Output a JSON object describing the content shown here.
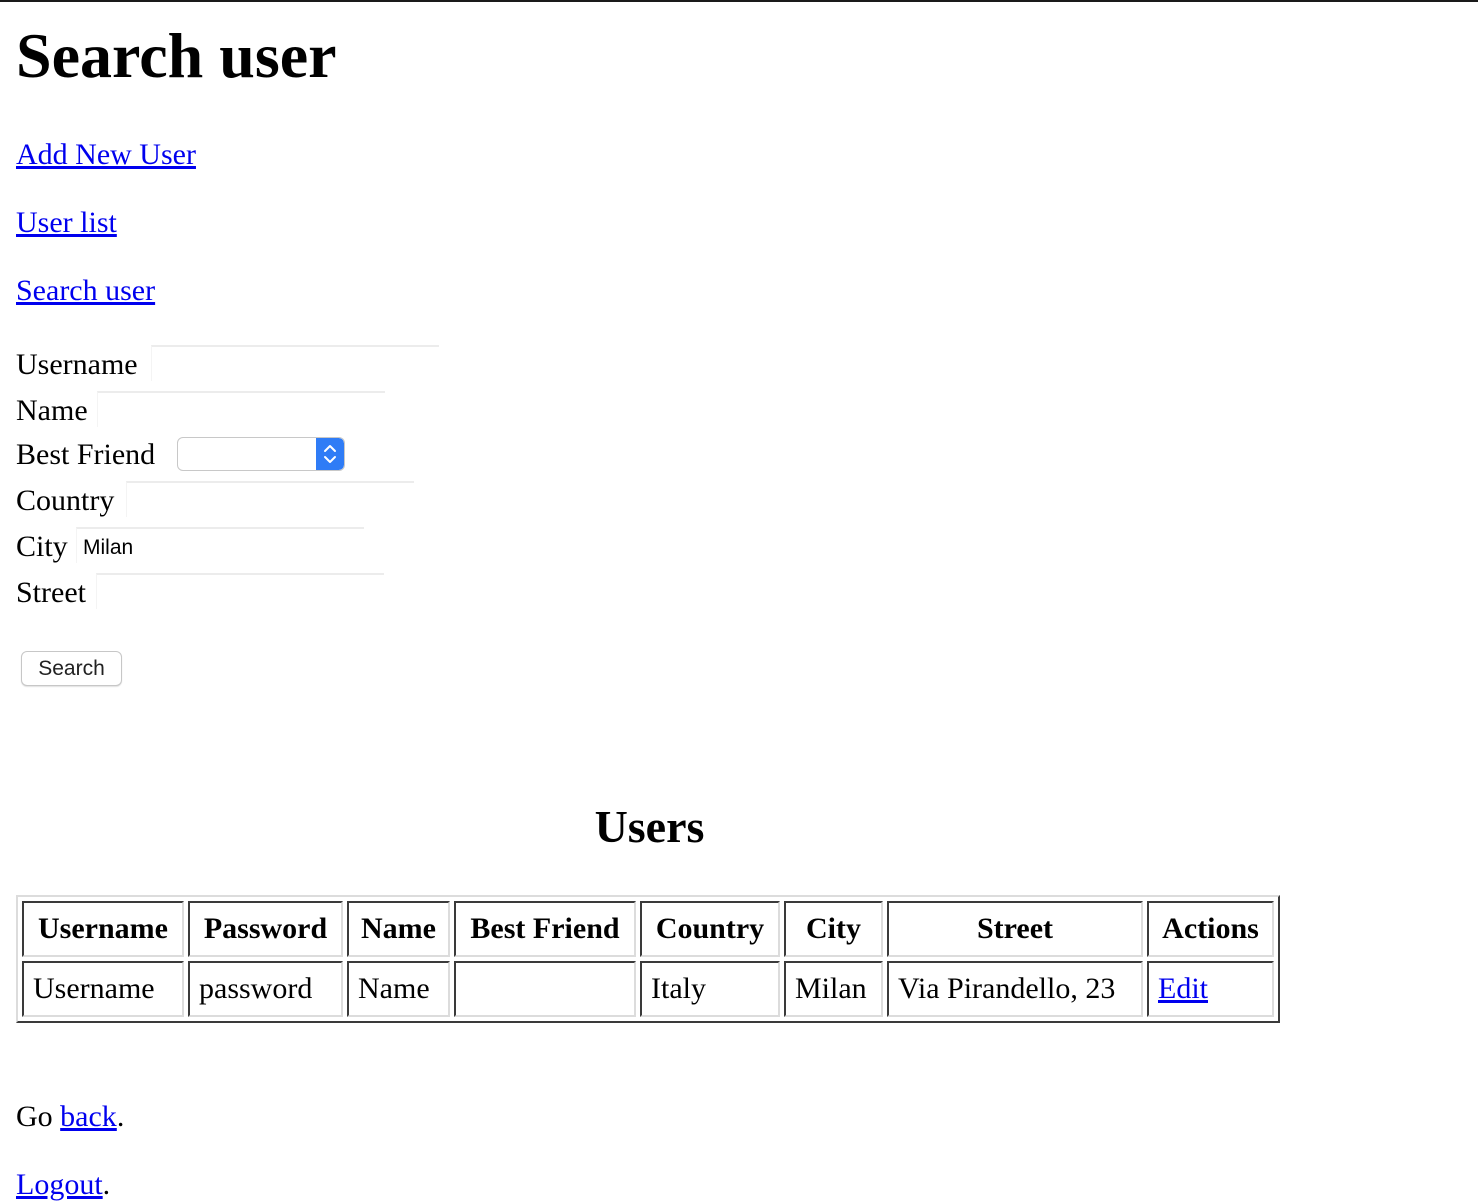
{
  "page": {
    "title": "Search user"
  },
  "nav": {
    "add_new_user": "Add New User",
    "user_list": "User list",
    "search_user": "Search user"
  },
  "form": {
    "username": {
      "label": "Username",
      "value": ""
    },
    "name": {
      "label": "Name",
      "value": ""
    },
    "best_friend": {
      "label": "Best Friend",
      "selected": ""
    },
    "country": {
      "label": "Country",
      "value": ""
    },
    "city": {
      "label": "City",
      "value": "Milan"
    },
    "street": {
      "label": "Street",
      "value": ""
    },
    "submit_label": "Search"
  },
  "results": {
    "heading": "Users",
    "columns": [
      "Username",
      "Password",
      "Name",
      "Best Friend",
      "Country",
      "City",
      "Street",
      "Actions"
    ],
    "rows": [
      {
        "username": "Username",
        "password": "password",
        "name": "Name",
        "best_friend": "",
        "country": "Italy",
        "city": "Milan",
        "street": "Via Pirandello, 23",
        "action": "Edit"
      }
    ]
  },
  "footer": {
    "go_prefix": "Go ",
    "back_link": "back",
    "go_suffix": ".",
    "logout_link": "Logout",
    "logout_suffix": "."
  },
  "colors": {
    "link": "#0000ee",
    "select_accent": "#2f7cf6"
  }
}
